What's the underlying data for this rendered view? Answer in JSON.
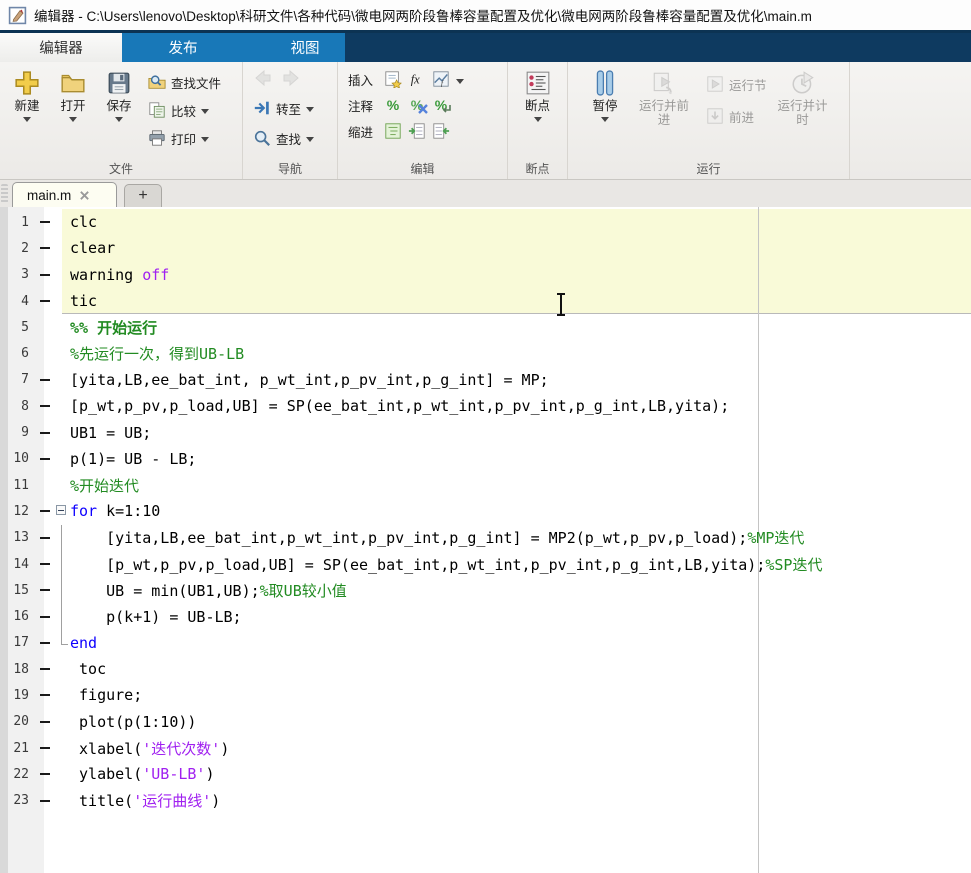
{
  "window": {
    "title": "编辑器 - C:\\Users\\lenovo\\Desktop\\科研文件\\各种代码\\微电网两阶段鲁棒容量配置及优化\\微电网两阶段鲁棒容量配置及优化\\main.m"
  },
  "colors": {
    "ribbon_blue": "#1878b8",
    "ribbon_dark": "#0e3a60",
    "section_highlight": "#f9fad8",
    "keyword": "#0e00ff",
    "comment": "#228b22",
    "string": "#a020f0"
  },
  "ribbon_tabs": [
    {
      "label": "编辑器",
      "active": true
    },
    {
      "label": "发布",
      "active": false
    },
    {
      "label": "视图",
      "active": false
    }
  ],
  "toolbar": {
    "file_group": {
      "label": "文件",
      "new": "新建",
      "open": "打开",
      "save": "保存",
      "find_files": "查找文件",
      "compare": "比较",
      "print": "打印"
    },
    "nav_group": {
      "label": "导航",
      "goto": "转至",
      "find": "查找"
    },
    "edit_group": {
      "label": "编辑",
      "insert": "插入",
      "comment": "注释",
      "indent": "缩进"
    },
    "breakpoint_group": {
      "label": "断点",
      "breakpoints": "断点"
    },
    "run_group": {
      "label": "运行",
      "pause": "暂停",
      "run_advance": "运行并前进",
      "run_section": "运行节",
      "advance": "前进",
      "run_time": "运行并计时"
    }
  },
  "glyphs": {
    "fx": "fx",
    "percent": "%",
    "new_tab": "+"
  },
  "tabbar": {
    "active_tab": "main.m"
  },
  "editor": {
    "highlighted_section_lines": "1-4",
    "lines": [
      {
        "n": 1,
        "x": true,
        "f": null,
        "s": [
          [
            "p",
            "clc"
          ]
        ]
      },
      {
        "n": 2,
        "x": true,
        "f": null,
        "s": [
          [
            "p",
            "clear"
          ]
        ]
      },
      {
        "n": 3,
        "x": true,
        "f": null,
        "s": [
          [
            "p",
            "warning "
          ],
          [
            "s",
            "off"
          ]
        ]
      },
      {
        "n": 4,
        "x": true,
        "f": null,
        "s": [
          [
            "p",
            "tic"
          ]
        ]
      },
      {
        "n": 5,
        "x": false,
        "f": null,
        "s": [
          [
            "b",
            "%% 开始运行"
          ]
        ]
      },
      {
        "n": 6,
        "x": false,
        "f": null,
        "s": [
          [
            "c",
            "%先运行一次，得到UB-LB"
          ]
        ]
      },
      {
        "n": 7,
        "x": true,
        "f": null,
        "s": [
          [
            "p",
            "[yita,LB,ee_bat_int, p_wt_int,p_pv_int,p_g_int] = MP;"
          ]
        ]
      },
      {
        "n": 8,
        "x": true,
        "f": null,
        "s": [
          [
            "p",
            "[p_wt,p_pv,p_load,UB] = SP(ee_bat_int,p_wt_int,p_pv_int,p_g_int,LB,yita);"
          ]
        ]
      },
      {
        "n": 9,
        "x": true,
        "f": null,
        "s": [
          [
            "p",
            "UB1 = UB;"
          ]
        ]
      },
      {
        "n": 10,
        "x": true,
        "f": null,
        "s": [
          [
            "p",
            "p(1)= UB - LB;"
          ]
        ]
      },
      {
        "n": 11,
        "x": false,
        "f": null,
        "s": [
          [
            "c",
            "%开始迭代"
          ]
        ]
      },
      {
        "n": 12,
        "x": true,
        "f": "start",
        "s": [
          [
            "k",
            "for"
          ],
          [
            "p",
            " k=1:10"
          ]
        ]
      },
      {
        "n": 13,
        "x": true,
        "f": "mid",
        "s": [
          [
            "p",
            "    [yita,LB,ee_bat_int,p_wt_int,p_pv_int,p_g_int] = MP2(p_wt,p_pv,p_load);"
          ],
          [
            "c",
            "%MP迭代"
          ]
        ]
      },
      {
        "n": 14,
        "x": true,
        "f": "mid",
        "s": [
          [
            "p",
            "    [p_wt,p_pv,p_load,UB] = SP(ee_bat_int,p_wt_int,p_pv_int,p_g_int,LB,yita);"
          ],
          [
            "c",
            "%SP迭代"
          ]
        ]
      },
      {
        "n": 15,
        "x": true,
        "f": "mid",
        "s": [
          [
            "p",
            "    UB = min(UB1,UB);"
          ],
          [
            "c",
            "%取UB较小值"
          ]
        ]
      },
      {
        "n": 16,
        "x": true,
        "f": "mid",
        "s": [
          [
            "p",
            "    p(k+1) = UB-LB;"
          ]
        ]
      },
      {
        "n": 17,
        "x": true,
        "f": "end",
        "s": [
          [
            "k",
            "end"
          ]
        ]
      },
      {
        "n": 18,
        "x": true,
        "f": null,
        "s": [
          [
            "p",
            " toc"
          ]
        ]
      },
      {
        "n": 19,
        "x": true,
        "f": null,
        "s": [
          [
            "p",
            " figure;"
          ]
        ]
      },
      {
        "n": 20,
        "x": true,
        "f": null,
        "s": [
          [
            "p",
            " plot(p(1:10))"
          ]
        ]
      },
      {
        "n": 21,
        "x": true,
        "f": null,
        "s": [
          [
            "p",
            " xlabel("
          ],
          [
            "s",
            "'迭代次数'"
          ],
          [
            "p",
            ")"
          ]
        ]
      },
      {
        "n": 22,
        "x": true,
        "f": null,
        "s": [
          [
            "p",
            " ylabel("
          ],
          [
            "s",
            "'UB-LB'"
          ],
          [
            "p",
            ")"
          ]
        ]
      },
      {
        "n": 23,
        "x": true,
        "f": null,
        "s": [
          [
            "p",
            " title("
          ],
          [
            "s",
            "'运行曲线'"
          ],
          [
            "p",
            ")"
          ]
        ]
      }
    ]
  }
}
